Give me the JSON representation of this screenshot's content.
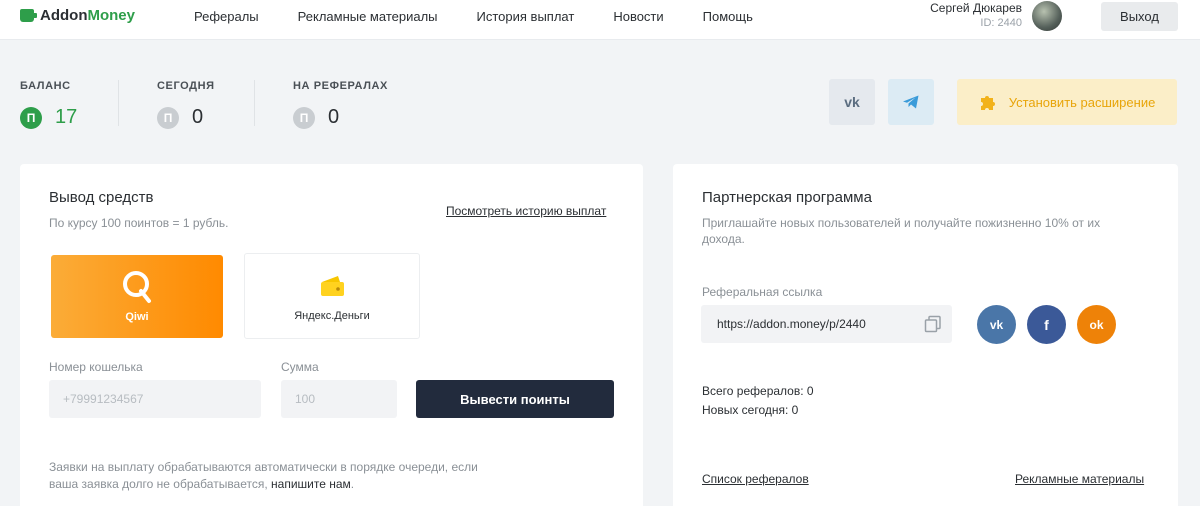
{
  "header": {
    "logo_part1": "Addon",
    "logo_part2": "Money",
    "nav": [
      "Рефералы",
      "Рекламные материалы",
      "История выплат",
      "Новости",
      "Помощь"
    ],
    "user_name": "Сергей Дюкарев",
    "user_id": "ID: 2440",
    "logout_label": "Выход"
  },
  "stats": [
    {
      "label": "БАЛАНС",
      "coin": "П",
      "value": "17"
    },
    {
      "label": "СЕГОДНЯ",
      "coin": "П",
      "value": "0"
    },
    {
      "label": "НА РЕФЕРАЛАХ",
      "coin": "П",
      "value": "0"
    }
  ],
  "social": {
    "vk_label": "vk",
    "install_extension": "Установить расширение"
  },
  "withdraw": {
    "title": "Вывод средств",
    "rate": "По курсу 100 поинтов = 1 рубль.",
    "history_link": "Посмотреть историю выплат",
    "methods": [
      "Qiwi",
      "Яндекс.Деньги"
    ],
    "wallet_label": "Номер кошелька",
    "wallet_placeholder": "+79991234567",
    "amount_label": "Сумма",
    "amount_placeholder": "100",
    "submit_label": "Вывести поинты",
    "note_text": "Заявки на выплату обрабатываются автоматически в порядке очереди, если ваша заявка долго не обрабатывается, ",
    "note_link": "напишите нам",
    "note_end": "."
  },
  "partner": {
    "title": "Партнерская программа",
    "description": "Приглашайте новых пользователей и получайте пожизненно 10% от их дохода.",
    "ref_label": "Реферальная ссылка",
    "ref_link": "https://addon.money/p/2440",
    "share": {
      "vk": "vk",
      "fb": "f",
      "ok": "ok"
    },
    "total_referrals": "Всего рефералов: 0",
    "new_today": "Новых сегодня: 0",
    "referrals_link": "Список рефералов",
    "materials_link": "Рекламные материалы"
  },
  "colors": {
    "accent_green": "#2e9e4a",
    "qiwi_orange": "#ff8a00",
    "dark_button": "#222b3d",
    "extension_yellow": "#e8a50a",
    "vk_blue": "#4a76a8",
    "fb_blue": "#3b5998",
    "ok_orange": "#ee8208"
  },
  "icons": [
    "wallet-icon",
    "vk-icon",
    "telegram-icon",
    "puzzle-icon",
    "qiwi-icon",
    "yandex-wallet-icon",
    "copy-icon",
    "facebook-icon",
    "odnoklassniki-icon"
  ]
}
